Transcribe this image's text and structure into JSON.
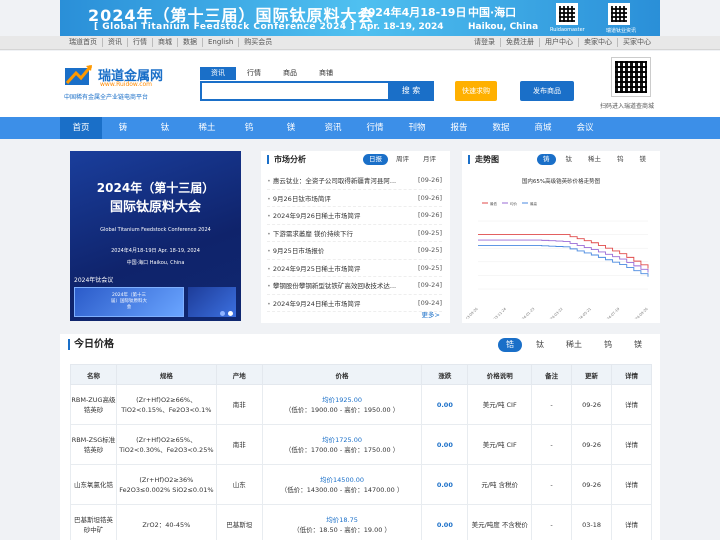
{
  "banner": {
    "title": "2024年（第十三届）国际钛原料大会",
    "date": "2024年4月18-19日",
    "city": "中国·海口",
    "subtitle": "[    Global Titanium Feedstock Conference 2024    ]",
    "date_en": "Apr. 18-19, 2024",
    "city_en": "Haikou, China",
    "qr1_caption": "Ruidaomaster",
    "qr2_caption": "瑞道钛业资讯"
  },
  "topbar": {
    "left_links": [
      "瑞道首页",
      "资讯",
      "行情",
      "商城",
      "数据",
      "English",
      "购买会员"
    ],
    "right_links": [
      "请登录",
      "免费注册",
      "用户中心",
      "卖家中心",
      "买家中心"
    ]
  },
  "header": {
    "logo_text": "瑞道金属网",
    "logo_url": "www.Ruidow.com",
    "logo_sub": "中国稀有金属全产业链电商平台",
    "search_tabs": [
      "资讯",
      "行情",
      "商品",
      "商铺"
    ],
    "search_placeholder": "",
    "search_button": "搜 索",
    "quick_buy": "快速求购",
    "publish": "发布商品",
    "qr_caption": "扫码进入瑞道查商城"
  },
  "nav": {
    "items": [
      "首页",
      "铸",
      "钛",
      "稀土",
      "钨",
      "镁",
      "资讯",
      "行情",
      "刊物",
      "报告",
      "数据",
      "商城",
      "会议"
    ]
  },
  "feature": {
    "title1": "2024年（第十三届）",
    "title2": "国际钛原料大会",
    "en": "Global Titanium Feedstock Conference 2024",
    "date": "2024年4月18-19日    Apr. 18-19, 2024",
    "city": "中国·海口    Haikou, China",
    "caption": "2024年钛会议",
    "thumb_text": "2024年（第十三届）国际钛原料大会"
  },
  "market": {
    "title": "市场分析",
    "tabs": [
      "日报",
      "周评",
      "月评"
    ],
    "items": [
      {
        "title": "惠云钛业：全资子公司取得新疆青河县阿...",
        "date": "[09-26]"
      },
      {
        "title": "9月26日钛市场简评",
        "date": "[09-26]"
      },
      {
        "title": "2024年9月26日稀土市场简评",
        "date": "[09-26]"
      },
      {
        "title": "下游需求萎靡 镁价持续下行",
        "date": "[09-25]"
      },
      {
        "title": "9月25日市场报价",
        "date": "[09-25]"
      },
      {
        "title": "2024年9月25日稀土市场简评",
        "date": "[09-25]"
      },
      {
        "title": "攀钢股份攀钢新型钛铁矿高效回收技术达...",
        "date": "[09-24]"
      },
      {
        "title": "2024年9月24日稀土市场简评",
        "date": "[09-24]"
      }
    ],
    "more": "更多>"
  },
  "trend": {
    "title": "走势图",
    "tabs": [
      "铸",
      "钛",
      "稀土",
      "钨",
      "镁"
    ]
  },
  "chart_data": {
    "type": "line",
    "title": "国内65%高级锆英砂价格走势图",
    "x": [
      "2023-09-26",
      "2023-11-24",
      "2024-01-23",
      "2024-03-22",
      "2024-05-21",
      "2024-07-19",
      "2024-09-26"
    ],
    "series": [
      {
        "name": "",
        "values": [
          10,
          10,
          10,
          10,
          9.4,
          8.6,
          7.5
        ],
        "color": "#e04a4a"
      },
      {
        "name": "",
        "values": [
          9.6,
          9.6,
          9.6,
          9.5,
          8.9,
          8.2,
          7.2
        ],
        "color": "#9a6bd6"
      },
      {
        "name": "",
        "values": [
          9.2,
          9.2,
          9.2,
          9.1,
          8.5,
          7.8,
          6.9
        ],
        "color": "#4a8ae0"
      }
    ],
    "legend": [
      "最低",
      "均价",
      "最高"
    ],
    "ylim": [
      6,
      11
    ],
    "grid": true,
    "legend_position": "top-left"
  },
  "today": {
    "title": "今日价格",
    "tabs": [
      "锆",
      "钛",
      "稀土",
      "钨",
      "镁"
    ],
    "columns": [
      "名称",
      "规格",
      "产地",
      "价格",
      "涨跌",
      "价格说明",
      "备注",
      "更新",
      "详情"
    ],
    "rows": [
      {
        "name": "RBM-ZUG高级锆英砂",
        "spec": "(Zr+Hf)O2≥66%、TiO2<0.15%、Fe2O3<0.1%",
        "origin": "南非",
        "avg": "均价1925.00",
        "range": "（低价：1900.00 - 高价：1950.00 ）",
        "change": "0.00",
        "note": "美元/吨 CIF",
        "remark": "-",
        "updated": "09-26",
        "detail": "详情"
      },
      {
        "name": "RBM-ZSG标准锆英砂",
        "spec": "(Zr+Hf)O2≥65%、TiO2<0.30%、Fe2O3<0.25%",
        "origin": "南非",
        "avg": "均价1725.00",
        "range": "（低价：1700.00 - 高价：1750.00 ）",
        "change": "0.00",
        "note": "美元/吨 CIF",
        "remark": "-",
        "updated": "09-26",
        "detail": "详情"
      },
      {
        "name": "山东氧氯化锆",
        "spec": "(Zr+Hf)O2≥36% Fe2O3≤0.002% SiO2≤0.01%",
        "origin": "山东",
        "avg": "均价14500.00",
        "range": "（低价：14300.00 - 高价：14700.00 ）",
        "change": "0.00",
        "note": "元/吨 含税价",
        "remark": "-",
        "updated": "09-26",
        "detail": "详情"
      },
      {
        "name": "巴基斯坦锆英砂中矿",
        "spec": "ZrO2：40-45%",
        "origin": "巴基斯坦",
        "avg": "均价18.75",
        "range": "（低价：18.50 - 高价：19.00 ）",
        "change": "0.00",
        "note": "美元/吨度 不含税价",
        "remark": "-",
        "updated": "03-18",
        "detail": "详情"
      }
    ]
  }
}
